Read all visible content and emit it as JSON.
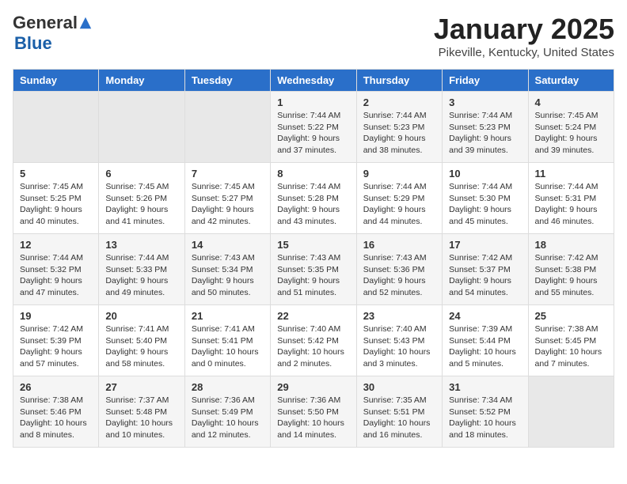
{
  "logo": {
    "general": "General",
    "blue": "Blue"
  },
  "header": {
    "title": "January 2025",
    "subtitle": "Pikeville, Kentucky, United States"
  },
  "days_of_week": [
    "Sunday",
    "Monday",
    "Tuesday",
    "Wednesday",
    "Thursday",
    "Friday",
    "Saturday"
  ],
  "weeks": [
    [
      {
        "day": "",
        "info": ""
      },
      {
        "day": "",
        "info": ""
      },
      {
        "day": "",
        "info": ""
      },
      {
        "day": "1",
        "info": "Sunrise: 7:44 AM\nSunset: 5:22 PM\nDaylight: 9 hours and 37 minutes."
      },
      {
        "day": "2",
        "info": "Sunrise: 7:44 AM\nSunset: 5:23 PM\nDaylight: 9 hours and 38 minutes."
      },
      {
        "day": "3",
        "info": "Sunrise: 7:44 AM\nSunset: 5:23 PM\nDaylight: 9 hours and 39 minutes."
      },
      {
        "day": "4",
        "info": "Sunrise: 7:45 AM\nSunset: 5:24 PM\nDaylight: 9 hours and 39 minutes."
      }
    ],
    [
      {
        "day": "5",
        "info": "Sunrise: 7:45 AM\nSunset: 5:25 PM\nDaylight: 9 hours and 40 minutes."
      },
      {
        "day": "6",
        "info": "Sunrise: 7:45 AM\nSunset: 5:26 PM\nDaylight: 9 hours and 41 minutes."
      },
      {
        "day": "7",
        "info": "Sunrise: 7:45 AM\nSunset: 5:27 PM\nDaylight: 9 hours and 42 minutes."
      },
      {
        "day": "8",
        "info": "Sunrise: 7:44 AM\nSunset: 5:28 PM\nDaylight: 9 hours and 43 minutes."
      },
      {
        "day": "9",
        "info": "Sunrise: 7:44 AM\nSunset: 5:29 PM\nDaylight: 9 hours and 44 minutes."
      },
      {
        "day": "10",
        "info": "Sunrise: 7:44 AM\nSunset: 5:30 PM\nDaylight: 9 hours and 45 minutes."
      },
      {
        "day": "11",
        "info": "Sunrise: 7:44 AM\nSunset: 5:31 PM\nDaylight: 9 hours and 46 minutes."
      }
    ],
    [
      {
        "day": "12",
        "info": "Sunrise: 7:44 AM\nSunset: 5:32 PM\nDaylight: 9 hours and 47 minutes."
      },
      {
        "day": "13",
        "info": "Sunrise: 7:44 AM\nSunset: 5:33 PM\nDaylight: 9 hours and 49 minutes."
      },
      {
        "day": "14",
        "info": "Sunrise: 7:43 AM\nSunset: 5:34 PM\nDaylight: 9 hours and 50 minutes."
      },
      {
        "day": "15",
        "info": "Sunrise: 7:43 AM\nSunset: 5:35 PM\nDaylight: 9 hours and 51 minutes."
      },
      {
        "day": "16",
        "info": "Sunrise: 7:43 AM\nSunset: 5:36 PM\nDaylight: 9 hours and 52 minutes."
      },
      {
        "day": "17",
        "info": "Sunrise: 7:42 AM\nSunset: 5:37 PM\nDaylight: 9 hours and 54 minutes."
      },
      {
        "day": "18",
        "info": "Sunrise: 7:42 AM\nSunset: 5:38 PM\nDaylight: 9 hours and 55 minutes."
      }
    ],
    [
      {
        "day": "19",
        "info": "Sunrise: 7:42 AM\nSunset: 5:39 PM\nDaylight: 9 hours and 57 minutes."
      },
      {
        "day": "20",
        "info": "Sunrise: 7:41 AM\nSunset: 5:40 PM\nDaylight: 9 hours and 58 minutes."
      },
      {
        "day": "21",
        "info": "Sunrise: 7:41 AM\nSunset: 5:41 PM\nDaylight: 10 hours and 0 minutes."
      },
      {
        "day": "22",
        "info": "Sunrise: 7:40 AM\nSunset: 5:42 PM\nDaylight: 10 hours and 2 minutes."
      },
      {
        "day": "23",
        "info": "Sunrise: 7:40 AM\nSunset: 5:43 PM\nDaylight: 10 hours and 3 minutes."
      },
      {
        "day": "24",
        "info": "Sunrise: 7:39 AM\nSunset: 5:44 PM\nDaylight: 10 hours and 5 minutes."
      },
      {
        "day": "25",
        "info": "Sunrise: 7:38 AM\nSunset: 5:45 PM\nDaylight: 10 hours and 7 minutes."
      }
    ],
    [
      {
        "day": "26",
        "info": "Sunrise: 7:38 AM\nSunset: 5:46 PM\nDaylight: 10 hours and 8 minutes."
      },
      {
        "day": "27",
        "info": "Sunrise: 7:37 AM\nSunset: 5:48 PM\nDaylight: 10 hours and 10 minutes."
      },
      {
        "day": "28",
        "info": "Sunrise: 7:36 AM\nSunset: 5:49 PM\nDaylight: 10 hours and 12 minutes."
      },
      {
        "day": "29",
        "info": "Sunrise: 7:36 AM\nSunset: 5:50 PM\nDaylight: 10 hours and 14 minutes."
      },
      {
        "day": "30",
        "info": "Sunrise: 7:35 AM\nSunset: 5:51 PM\nDaylight: 10 hours and 16 minutes."
      },
      {
        "day": "31",
        "info": "Sunrise: 7:34 AM\nSunset: 5:52 PM\nDaylight: 10 hours and 18 minutes."
      },
      {
        "day": "",
        "info": ""
      }
    ]
  ]
}
